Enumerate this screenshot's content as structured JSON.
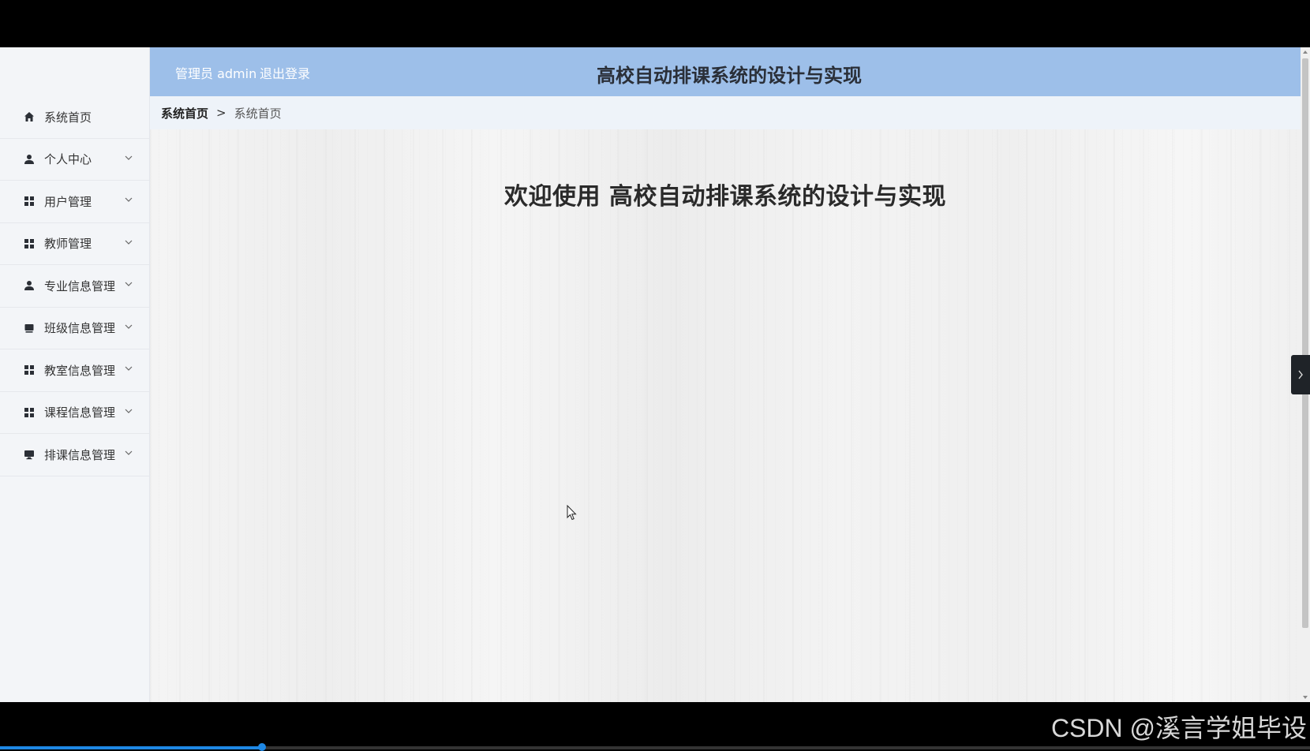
{
  "header": {
    "admin_label": "管理员 admin",
    "logout_label": "退出登录",
    "title": "高校自动排课系统的设计与实现"
  },
  "sidebar": {
    "items": [
      {
        "label": "系统首页",
        "icon": "home-icon",
        "has_submenu": false
      },
      {
        "label": "个人中心",
        "icon": "user-icon",
        "has_submenu": true
      },
      {
        "label": "用户管理",
        "icon": "grid-icon",
        "has_submenu": true
      },
      {
        "label": "教师管理",
        "icon": "grid-icon",
        "has_submenu": true
      },
      {
        "label": "专业信息管理",
        "icon": "user-icon",
        "has_submenu": true
      },
      {
        "label": "班级信息管理",
        "icon": "book-icon",
        "has_submenu": true
      },
      {
        "label": "教室信息管理",
        "icon": "grid-icon",
        "has_submenu": true
      },
      {
        "label": "课程信息管理",
        "icon": "grid-icon",
        "has_submenu": true
      },
      {
        "label": "排课信息管理",
        "icon": "monitor-icon",
        "has_submenu": true
      }
    ]
  },
  "breadcrumb": {
    "home": "系统首页",
    "separator": ">",
    "current": "系统首页"
  },
  "content": {
    "welcome": "欢迎使用 高校自动排课系统的设计与实现"
  },
  "watermark": "CSDN @溪言学姐毕设",
  "video_progress": 0.2,
  "colors": {
    "header_bg": "#9dbfe9",
    "sidebar_bg": "#f3f5f8",
    "breadcrumb_bg": "#eef3f9",
    "progress": "#1e88e5"
  }
}
